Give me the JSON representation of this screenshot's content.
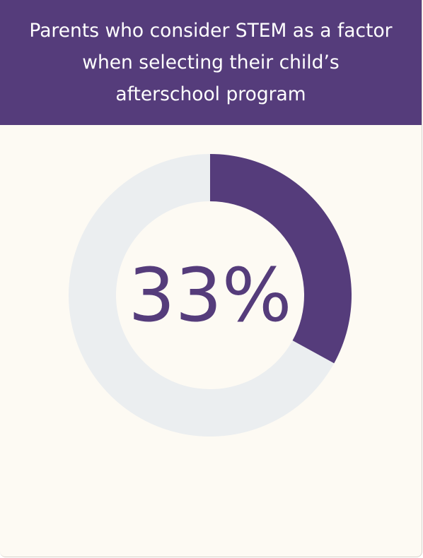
{
  "chart_data": {
    "type": "pie",
    "title": "Parents who consider STEM as a factor when selecting their child’s afterschool program",
    "values": [
      33,
      67
    ],
    "center_label": "33%",
    "colors": {
      "value": "#553c7b",
      "remainder": "#ebeef0",
      "header_background": "#553c7b",
      "card_background": "#fdfaf3",
      "title_text": "#ffffff",
      "center_text": "#553c7b"
    }
  }
}
